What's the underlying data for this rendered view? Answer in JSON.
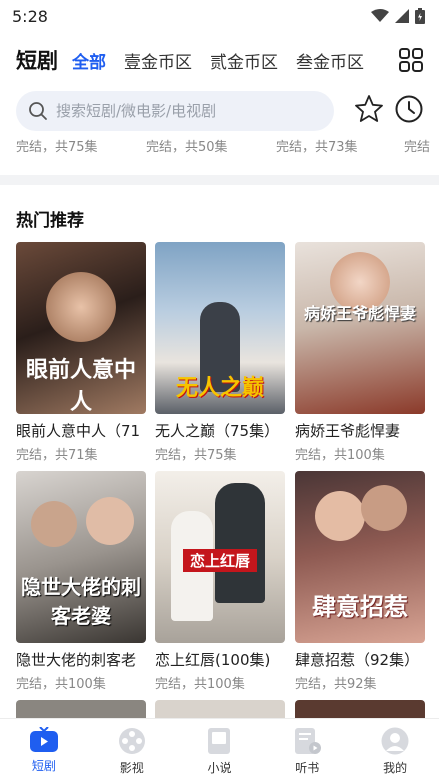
{
  "status_bar": {
    "time": "5:28"
  },
  "header": {
    "title": "短剧",
    "tabs": [
      {
        "label": "全部",
        "active": true
      },
      {
        "label": "壹金币区",
        "active": false
      },
      {
        "label": "贰金币区",
        "active": false
      },
      {
        "label": "叁金币区",
        "active": false
      }
    ]
  },
  "search": {
    "placeholder": "搜索短剧/微电影/电视剧"
  },
  "previous_row": [
    "完结，共75集",
    "完结，共50集",
    "完结，共73集",
    "完结"
  ],
  "section": {
    "title": "热门推荐"
  },
  "cards": [
    {
      "title": "眼前人意中人（71",
      "subtitle": "完结，共71集",
      "poster_text": "眼前人意中人"
    },
    {
      "title": "无人之巅（75集）",
      "subtitle": "完结，共75集",
      "poster_text": "无人之巅"
    },
    {
      "title": "病娇王爷彪悍妻",
      "subtitle": "完结，共100集",
      "poster_text": "病娇王爷彪悍妻"
    },
    {
      "title": "隐世大佬的刺客老",
      "subtitle": "完结，共100集",
      "poster_text": "隐世大佬的刺客老婆"
    },
    {
      "title": "恋上红唇(100集)",
      "subtitle": "完结，共100集",
      "poster_text": "恋上红唇"
    },
    {
      "title": "肆意招惹（92集）",
      "subtitle": "完结，共92集",
      "poster_text": "肆意招惹"
    }
  ],
  "bottom_nav": [
    {
      "label": "短剧",
      "active": true
    },
    {
      "label": "影视",
      "active": false
    },
    {
      "label": "小说",
      "active": false
    },
    {
      "label": "听书",
      "active": false
    },
    {
      "label": "我的",
      "active": false
    }
  ],
  "colors": {
    "accent": "#1f5ef0",
    "search_bg": "#eef1f8",
    "muted": "#888888"
  }
}
